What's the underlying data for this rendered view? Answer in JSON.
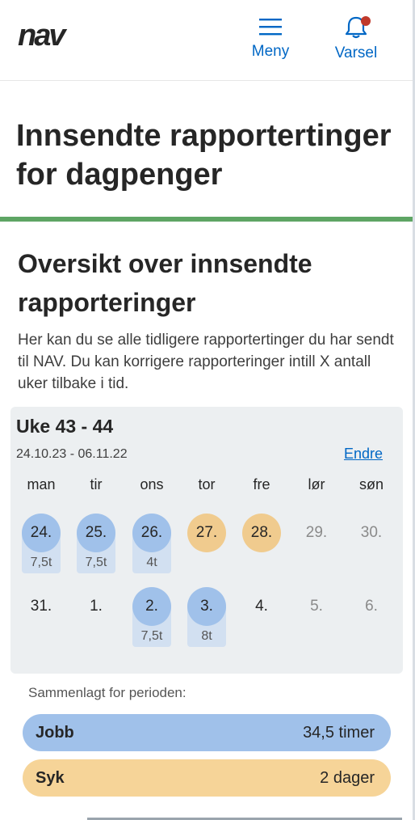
{
  "header": {
    "logo_text": "nav",
    "menu_label": "Meny",
    "notifications_label": "Varsel",
    "notification_dot_color": "#c0392b",
    "icons": {
      "menu": "hamburger-icon",
      "notifications": "bell-icon"
    }
  },
  "page_title": "Innsendte rapportertinger for dagpenger",
  "section": {
    "title": "Oversikt over innsendte rapporteringer",
    "intro": "Her kan du se alle tidligere rapportertinger du har sendt til NAV. Du kan korrigere rapporteringer intill X antall uker tilbake i tid."
  },
  "calendar": {
    "week_title": "Uke 43 - 44",
    "date_range": "24.10.23 - 06.11.22",
    "edit_label": "Endre",
    "weekdays": [
      "man",
      "tir",
      "ons",
      "tor",
      "fre",
      "lør",
      "søn"
    ],
    "weeks": [
      [
        {
          "day": "24.",
          "type": "work",
          "hours": "7,5t"
        },
        {
          "day": "25.",
          "type": "work",
          "hours": "7,5t"
        },
        {
          "day": "26.",
          "type": "work",
          "hours": "4t"
        },
        {
          "day": "27.",
          "type": "sick",
          "hours": ""
        },
        {
          "day": "28.",
          "type": "sick",
          "hours": ""
        },
        {
          "day": "29.",
          "type": "future",
          "hours": ""
        },
        {
          "day": "30.",
          "type": "future",
          "hours": ""
        }
      ],
      [
        {
          "day": "31.",
          "type": "none",
          "hours": ""
        },
        {
          "day": "1.",
          "type": "none",
          "hours": ""
        },
        {
          "day": "2.",
          "type": "work",
          "hours": "7,5t"
        },
        {
          "day": "3.",
          "type": "work",
          "hours": "8t"
        },
        {
          "day": "4.",
          "type": "none",
          "hours": ""
        },
        {
          "day": "5.",
          "type": "future",
          "hours": ""
        },
        {
          "day": "6.",
          "type": "future",
          "hours": ""
        }
      ]
    ],
    "colors": {
      "work": "#a0c1ea",
      "sick": "#f0cb8e",
      "background": "#eceff1"
    }
  },
  "summary": {
    "label": "Sammenlagt for perioden:",
    "rows": [
      {
        "name": "Jobb",
        "value": "34,5 timer"
      },
      {
        "name": "Syk",
        "value": "2 dager"
      }
    ]
  }
}
